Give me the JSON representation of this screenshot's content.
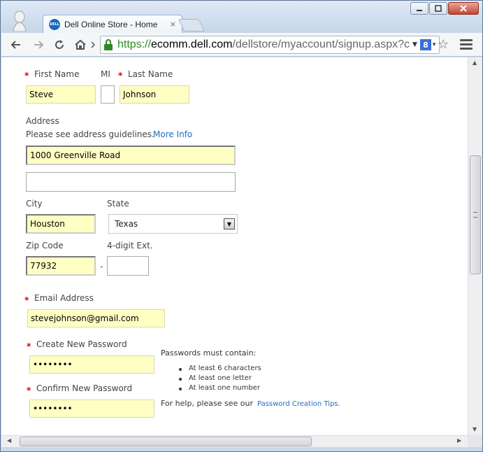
{
  "browser": {
    "tab_title": "Dell Online Store - Home",
    "tab_favicon": "DELL",
    "tab_close": "×",
    "url_scheme": "https://",
    "url_host": "ecomm.dell.com",
    "url_path": "/dellstore/myaccount/signup.aspx?c",
    "search_engine_letter": "8"
  },
  "form": {
    "required_mark": "*",
    "first_name_label": "First Name",
    "mi_label": "MI",
    "last_name_label": "Last Name",
    "first_name_value": "Steve",
    "mi_value": "",
    "last_name_value": "Johnson",
    "address_label": "Address",
    "address_hint": "Please see address guidelines.",
    "address_hint_link": "More Info",
    "address_line1_value": "1000 Greenville Road",
    "address_line2_value": "",
    "city_label": "City",
    "state_label": "State",
    "city_value": "Houston",
    "state_value": "Texas",
    "zip_label": "Zip Code",
    "ext_label": "4-digit Ext.",
    "zip_value": "77932",
    "zip_separator": "-",
    "ext_value": "",
    "email_label": "Email Address",
    "email_value": "stevejohnson@gmail.com",
    "password_label": "Create New Password",
    "password_value": "••••••••",
    "confirm_label": "Confirm New Password",
    "confirm_value": "••••••••"
  },
  "password_rules": {
    "heading": "Passwords must contain:",
    "items": [
      "At least 6 characters",
      "At least one letter",
      "At least one number"
    ],
    "help_text": "For help, please see our",
    "help_link": "Password Creation Tips."
  },
  "colors": {
    "autofill": "#ffffc4",
    "link": "#1f6fbf",
    "required": "#cc0000",
    "secure_green": "#2f8a2a"
  }
}
